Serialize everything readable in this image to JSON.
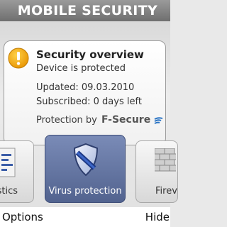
{
  "header": {
    "title": "MOBILE SECURITY"
  },
  "card": {
    "icon": "warning-icon",
    "title": "Security overview",
    "status": "Device is protected",
    "updated": "Updated: 09.03.2010",
    "subscribed": "Subscribed: 0 days left",
    "protection_by": "Protection by",
    "brand": "F-Secure"
  },
  "tiles": [
    {
      "label": "istics",
      "icon": "statistics-icon"
    },
    {
      "label": "Virus protection",
      "icon": "shield-icon",
      "selected": true
    },
    {
      "label": "Firev",
      "icon": "firewall-icon"
    }
  ],
  "softkeys": {
    "left": "Options",
    "right": "Hide"
  },
  "colors": {
    "accent": "#5b6d9c",
    "warning": "#f1a80a",
    "brand_blue": "#2a74c4"
  }
}
